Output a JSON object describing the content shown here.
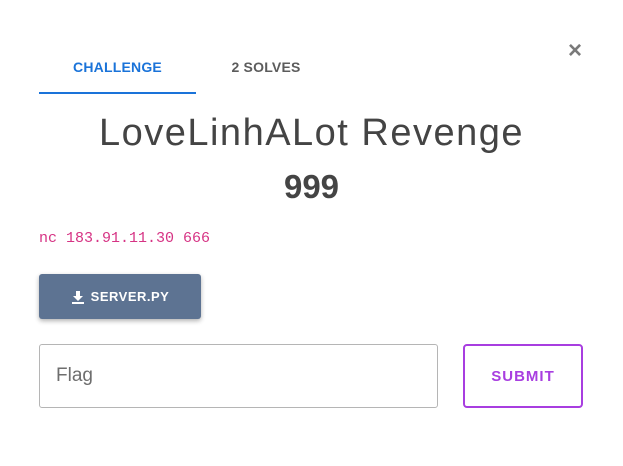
{
  "tabs": {
    "challenge": "CHALLENGE",
    "solves": "2 SOLVES"
  },
  "close_icon": "×",
  "challenge": {
    "name": "LoveLinhALot Revenge",
    "points": "999",
    "description": "nc 183.91.11.30 666"
  },
  "file": {
    "label": "SERVER.PY",
    "icon": "download-icon"
  },
  "flag": {
    "placeholder": "Flag",
    "value": ""
  },
  "submit_label": "SUBMIT",
  "colors": {
    "tab_active": "#1a73d9",
    "file_button": "#5d7392",
    "submit": "#a83ee0",
    "code": "#d63384"
  }
}
